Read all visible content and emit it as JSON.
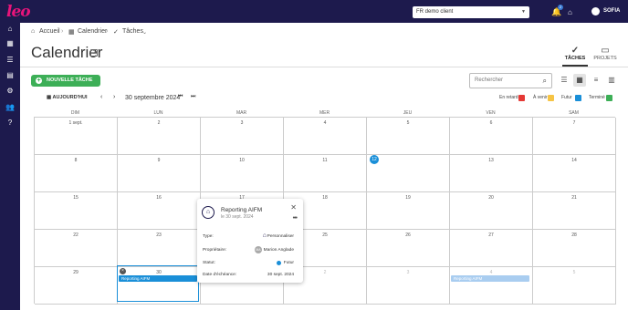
{
  "app": {
    "logo": "leo"
  },
  "topbar": {
    "client": "FR demo client",
    "notification_count": "2",
    "user_name": "SOFIA"
  },
  "breadcrumb": {
    "home": "Accueil",
    "calendar": "Calendrier",
    "tasks": "Tâches"
  },
  "page": {
    "title": "Calendrier"
  },
  "view_tabs": [
    {
      "label": "TÂCHES",
      "icon": "check-circle-icon",
      "active": true
    },
    {
      "label": "PROJETS",
      "icon": "folder-icon",
      "active": false
    }
  ],
  "toolbar": {
    "new_task": "NOUVELLE TÂCHE",
    "search_placeholder": "Rechercher"
  },
  "nav": {
    "today": "AUJOURD'HUI",
    "current_date": "30 septembre 2024"
  },
  "legend": [
    {
      "label": "En retard",
      "color": "#e53935"
    },
    {
      "label": "À venir",
      "color": "#f6c445"
    },
    {
      "label": "Futur",
      "color": "#1a8fd8"
    },
    {
      "label": "Terminé",
      "color": "#3daf57"
    }
  ],
  "calendar": {
    "weekdays": [
      "DIM",
      "LUN",
      "MAR",
      "MER",
      "JEU",
      "VEN",
      "SAM"
    ],
    "weeks": [
      [
        "1 sept.",
        "2",
        "3",
        "4",
        "5",
        "6",
        "7"
      ],
      [
        "8",
        "9",
        "10",
        "11",
        "12",
        "13",
        "14"
      ],
      [
        "15",
        "16",
        "17",
        "18",
        "19",
        "20",
        "21"
      ],
      [
        "22",
        "23",
        "24",
        "25",
        "26",
        "27",
        "28"
      ],
      [
        "29",
        "30",
        "1",
        "2",
        "3",
        "4",
        "5"
      ]
    ],
    "today": "12",
    "events": [
      {
        "title": "Reporting AIFM",
        "color": "#1a8fd8"
      },
      {
        "title": "Reporting AIFM",
        "color": "#a9cdf0"
      }
    ]
  },
  "popup": {
    "title": "Reporting AIFM",
    "subtitle": "le 30 sept. 2024",
    "rows": [
      {
        "label": "Type:",
        "value": "Personnaliser"
      },
      {
        "label": "Propriétaire:",
        "value": "Marion Anglade",
        "initials": "MA"
      },
      {
        "label": "Statut:",
        "value": "Futur"
      },
      {
        "label": "Date d'échéance:",
        "value": "30 sept. 2024"
      }
    ]
  }
}
